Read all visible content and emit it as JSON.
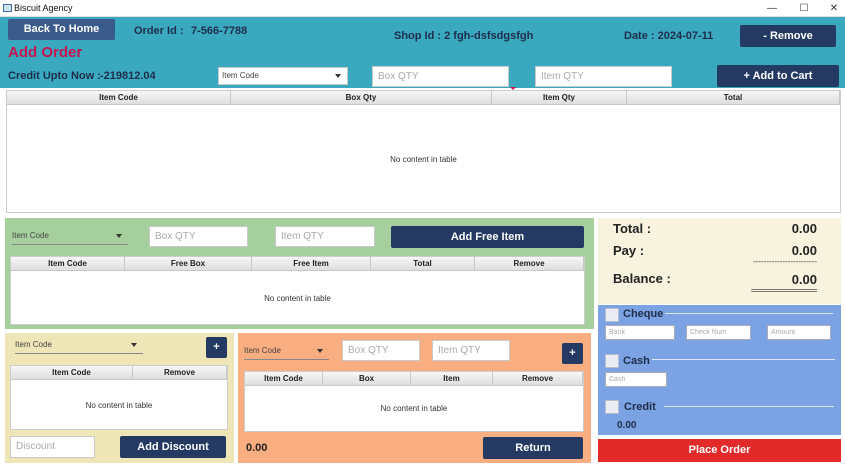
{
  "window": {
    "title": "Biscuit Agency",
    "min": "—",
    "max": "☐",
    "close": "✕"
  },
  "header": {
    "back_label": "Back To Home",
    "order_id_label": "Order Id :",
    "order_id_value": "7-566-7788",
    "shop_id": "Shop Id : 2 fgh-dsfsdgsfgh",
    "date": "Date : 2024-07-11",
    "remove_label": "- Remove",
    "page_title": "Add Order"
  },
  "cart": {
    "credit_label": "Credit Upto Now :",
    "credit_value": "-219812.04",
    "item_code_placeholder": "Item Code",
    "box_qty_placeholder": "Box QTY",
    "item_qty_placeholder": "Item QTY",
    "add_label": "+ Add to Cart",
    "columns": [
      "Item Code",
      "Box Qty",
      "Item Qty",
      "Total"
    ],
    "empty_text": "No content in table"
  },
  "free": {
    "item_code_placeholder": "Item Code",
    "box_qty_placeholder": "Box QTY",
    "item_qty_placeholder": "Item QTY",
    "add_label": "Add Free Item",
    "columns": [
      "Item Code",
      "Free Box",
      "Free Item",
      "Total",
      "Remove"
    ],
    "empty_text": "No content in table"
  },
  "discount": {
    "item_code_placeholder": "Item Code",
    "plus_label": "+",
    "columns": [
      "Item Code",
      "Remove"
    ],
    "empty_text": "No content in table",
    "discount_placeholder": "Discount",
    "add_label": "Add Discount"
  },
  "returns": {
    "item_code_placeholder": "Item Code",
    "box_qty_placeholder": "Box QTY",
    "item_qty_placeholder": "Item QTY",
    "plus_label": "+",
    "columns": [
      "Item Code",
      "Box",
      "Item",
      "Remove"
    ],
    "empty_text": "No content in table",
    "total": "0.00",
    "return_label": "Return"
  },
  "summary": {
    "total_label": "Total   :",
    "total_value": "0.00",
    "pay_label": "Pay     :",
    "pay_value": "0.00",
    "dash_line": "------------------------",
    "balance_label": "Balance :",
    "balance_value": "0.00",
    "eq_line": "=================="
  },
  "payment": {
    "cheque_label": "Cheque",
    "bank_placeholder": "Bank",
    "check_num_placeholder": "Check Num",
    "amount_placeholder": "Amount",
    "cash_label": "Cash",
    "cash_placeholder": "Cash",
    "credit_label": "Credit",
    "credit_value": "0.00"
  },
  "place_order_label": "Place Order",
  "colors": {
    "teal": "#3aa9bf",
    "navy": "#253a63",
    "green": "#a6cf9e",
    "yellow": "#efe6b7",
    "orange": "#f8ae80",
    "summary_bg": "#f7f3df",
    "payment_bg": "#7ba2e3",
    "place_order": "#e22a2a",
    "accent": "#c4154f"
  }
}
